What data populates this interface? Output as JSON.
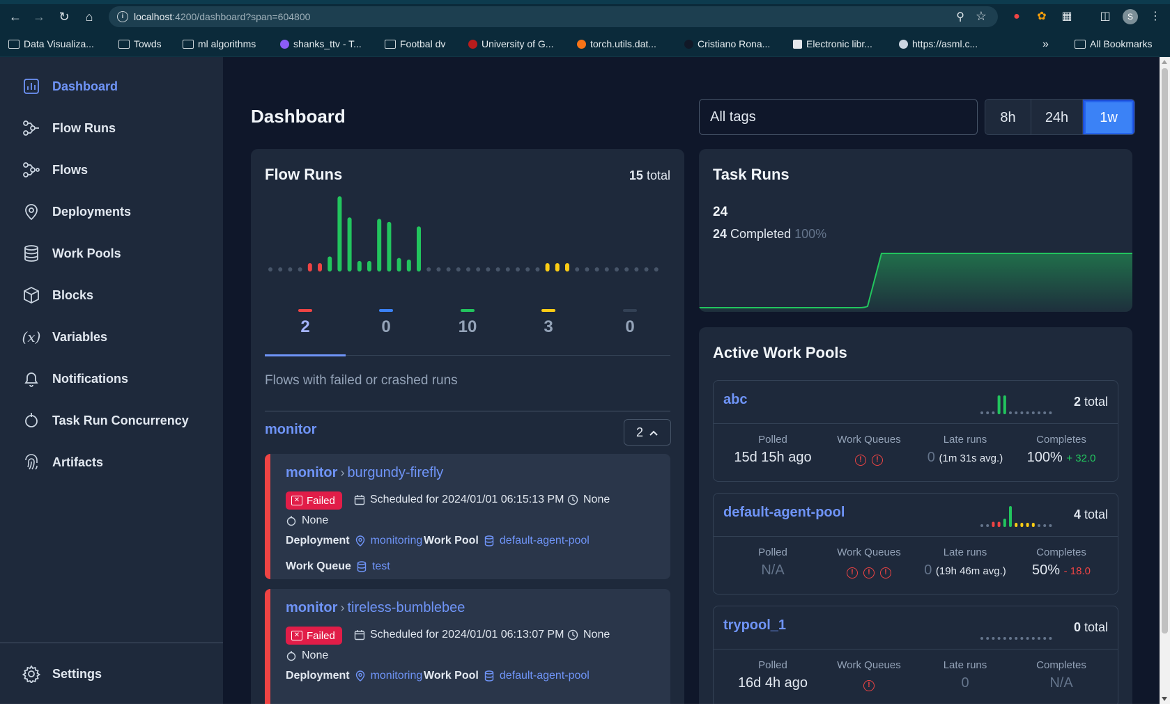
{
  "browser": {
    "url_host": "localhost",
    "url_rest": ":4200/dashboard?span=604800",
    "bookmarks": [
      "Data Visualiza...",
      "Towds",
      "ml algorithms",
      "shanks_ttv - T...",
      "Footbal dv",
      "University of G...",
      "torch.utils.dat...",
      "Cristiano Rona...",
      "Electronic libr...",
      "https://asml.c..."
    ],
    "more_bookmarks": "»",
    "all_bookmarks": "All Bookmarks",
    "profile_initial": "S"
  },
  "sidebar": {
    "items": [
      {
        "label": "Dashboard",
        "icon": "bar-chart-icon"
      },
      {
        "label": "Flow Runs",
        "icon": "flow-runs-icon"
      },
      {
        "label": "Flows",
        "icon": "flows-icon"
      },
      {
        "label": "Deployments",
        "icon": "map-pin-icon"
      },
      {
        "label": "Work Pools",
        "icon": "database-icon"
      },
      {
        "label": "Blocks",
        "icon": "cube-icon"
      },
      {
        "label": "Variables",
        "icon": "variable-icon"
      },
      {
        "label": "Notifications",
        "icon": "bell-icon"
      },
      {
        "label": "Task Run Concurrency",
        "icon": "concurrency-icon"
      },
      {
        "label": "Artifacts",
        "icon": "fingerprint-icon"
      }
    ],
    "settings_label": "Settings"
  },
  "header": {
    "title": "Dashboard",
    "tag_filter": "All tags",
    "spans": [
      "8h",
      "24h",
      "1w"
    ],
    "active_span": "1w"
  },
  "flow_runs": {
    "title": "Flow Runs",
    "total_count": "15",
    "total_label": "total",
    "state_tabs": [
      {
        "count": "2",
        "color": "#ef4444"
      },
      {
        "count": "0",
        "color": "#3b82f6"
      },
      {
        "count": "10",
        "color": "#22c55e"
      },
      {
        "count": "3",
        "color": "#facc15"
      },
      {
        "count": "0",
        "color": "#334155"
      }
    ],
    "failed_heading": "Flows with failed or crashed runs",
    "flow_name": "monitor",
    "flow_count": "2",
    "runs": [
      {
        "flow": "monitor",
        "name": "burgundy-firefly",
        "state": "Failed",
        "scheduled": "Scheduled for 2024/01/01 06:15:13 PM",
        "duration": "None",
        "tasks": "None",
        "deployment_label": "Deployment",
        "deployment": "monitoring",
        "work_pool_label": "Work Pool",
        "work_pool": "default-agent-pool",
        "work_queue_label": "Work Queue",
        "work_queue": "test"
      },
      {
        "flow": "monitor",
        "name": "tireless-bumblebee",
        "state": "Failed",
        "scheduled": "Scheduled for 2024/01/01 06:13:07 PM",
        "duration": "None",
        "tasks": "None",
        "deployment_label": "Deployment",
        "deployment": "monitoring",
        "work_pool_label": "Work Pool",
        "work_pool": "default-agent-pool"
      }
    ]
  },
  "chart_data": {
    "type": "bar",
    "bars": [
      0,
      0,
      0,
      0,
      0.1,
      0.1,
      0.2,
      1.0,
      0.72,
      0.14,
      0.14,
      0.7,
      0.66,
      0.18,
      0.16,
      0.6,
      0,
      0,
      0,
      0,
      0,
      0,
      0,
      0,
      0,
      0,
      0,
      0,
      0.1,
      0.1,
      0.1,
      0,
      0,
      0,
      0,
      0,
      0,
      0,
      0,
      0
    ],
    "bar_colors": [
      "#475569",
      "#475569",
      "#475569",
      "#475569",
      "#ef4444",
      "#ef4444",
      "#22c55e",
      "#22c55e",
      "#22c55e",
      "#22c55e",
      "#22c55e",
      "#22c55e",
      "#22c55e",
      "#22c55e",
      "#22c55e",
      "#22c55e",
      "#475569",
      "#475569",
      "#475569",
      "#475569",
      "#475569",
      "#475569",
      "#475569",
      "#475569",
      "#475569",
      "#475569",
      "#475569",
      "#475569",
      "#facc15",
      "#facc15",
      "#facc15",
      "#475569",
      "#475569",
      "#475569",
      "#475569",
      "#475569",
      "#475569",
      "#475569",
      "#475569",
      "#475569"
    ]
  },
  "task_runs": {
    "title": "Task Runs",
    "count": "24",
    "completed_count": "24",
    "completed_label": "Completed",
    "completed_pct": "100%"
  },
  "work_pools": {
    "title": "Active Work Pools",
    "col_polled": "Polled",
    "col_queues": "Work Queues",
    "col_late": "Late runs",
    "col_completes": "Completes",
    "pools": [
      {
        "name": "abc",
        "total": "2",
        "polled": "15d 15h ago",
        "queue_warnings": 2,
        "late": "0",
        "late_avg": "(1m 31s avg.)",
        "completes": "100%",
        "delta": "+ 32.0",
        "delta_dir": "up",
        "spark": [
          0,
          0,
          0,
          0.9,
          0.9,
          0,
          0,
          0,
          0,
          0,
          0,
          0,
          0
        ],
        "spark_colors": [
          "#64748b",
          "#64748b",
          "#64748b",
          "#22c55e",
          "#22c55e",
          "#64748b",
          "#64748b",
          "#64748b",
          "#64748b",
          "#64748b",
          "#64748b",
          "#64748b",
          "#64748b"
        ]
      },
      {
        "name": "default-agent-pool",
        "total": "4",
        "polled": "N/A",
        "queue_warnings": 3,
        "late": "0",
        "late_avg": "(19h 46m avg.)",
        "completes": "50%",
        "delta": "- 18.0",
        "delta_dir": "down",
        "spark": [
          0,
          0,
          0.25,
          0.25,
          0.4,
          1.0,
          0.2,
          0.2,
          0.2,
          0.2,
          0,
          0,
          0
        ],
        "spark_colors": [
          "#64748b",
          "#64748b",
          "#ef4444",
          "#ef4444",
          "#22c55e",
          "#22c55e",
          "#facc15",
          "#facc15",
          "#facc15",
          "#facc15",
          "#64748b",
          "#64748b",
          "#64748b"
        ]
      },
      {
        "name": "trypool_1",
        "total": "0",
        "polled": "16d 4h ago",
        "queue_warnings": 1,
        "late": "0",
        "late_avg": "",
        "completes": "N/A",
        "delta": "",
        "delta_dir": "",
        "spark": [
          0,
          0,
          0,
          0,
          0,
          0,
          0,
          0,
          0,
          0,
          0,
          0,
          0
        ],
        "spark_colors": [
          "#64748b",
          "#64748b",
          "#64748b",
          "#64748b",
          "#64748b",
          "#64748b",
          "#64748b",
          "#64748b",
          "#64748b",
          "#64748b",
          "#64748b",
          "#64748b",
          "#64748b"
        ]
      }
    ]
  }
}
